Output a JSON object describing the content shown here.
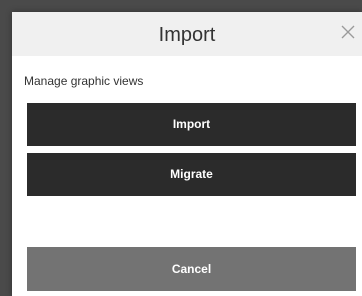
{
  "dialog": {
    "title": "Import",
    "close_icon": "close-icon",
    "subtitle": "Manage graphic views",
    "buttons": {
      "import_label": "Import",
      "migrate_label": "Migrate",
      "cancel_label": "Cancel"
    }
  },
  "colors": {
    "header_bg": "#f0f0f0",
    "primary_button": "#2b2b2b",
    "cancel_button": "#737373"
  }
}
